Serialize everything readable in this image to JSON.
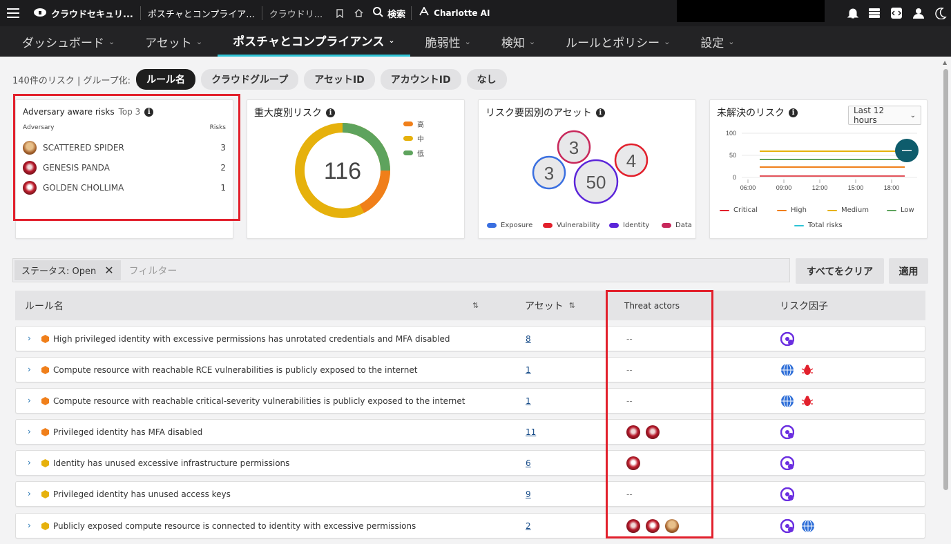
{
  "topbar": {
    "app_title": "クラウドセキュリ...",
    "crumb1": "ポスチャとコンプライア...",
    "crumb2": "クラウドリ...",
    "search_label": "検索",
    "charlotte_label": "Charlotte AI"
  },
  "nav": {
    "items": [
      {
        "label": "ダッシュボード"
      },
      {
        "label": "アセット"
      },
      {
        "label": "ポスチャとコンプライアンス"
      },
      {
        "label": "脆弱性"
      },
      {
        "label": "検知"
      },
      {
        "label": "ルールとポリシー"
      },
      {
        "label": "設定"
      }
    ]
  },
  "grouping": {
    "summary": "140件のリスク | グループ化:",
    "pills": [
      "ルール名",
      "クラウドグループ",
      "アセットID",
      "アカウントID",
      "なし"
    ]
  },
  "adversary_card": {
    "title": "Adversary aware risks",
    "top_label": "Top 3",
    "col_adversary": "Adversary",
    "col_risks": "Risks",
    "rows": [
      {
        "name": "SCATTERED SPIDER",
        "risks": "3"
      },
      {
        "name": "GENESIS PANDA",
        "risks": "2"
      },
      {
        "name": "GOLDEN CHOLLIMA",
        "risks": "1"
      }
    ]
  },
  "severity_card": {
    "title": "重大度別リスク",
    "total": "116",
    "legend": [
      "高",
      "中",
      "低"
    ]
  },
  "factor_card": {
    "title": "リスク要因別のアセット",
    "bubbles": [
      "3",
      "3",
      "50",
      "4"
    ],
    "legend": [
      "Exposure",
      "Vulnerability",
      "Identity",
      "Data"
    ]
  },
  "unresolved_card": {
    "title": "未解決のリスク",
    "range": "Last 12 hours",
    "y_ticks": [
      "100",
      "50",
      "0"
    ],
    "x_ticks": [
      "06:00",
      "09:00",
      "12:00",
      "15:00",
      "18:00"
    ],
    "legend": [
      "Critical",
      "High",
      "Medium",
      "Low",
      "Total risks"
    ]
  },
  "filter": {
    "chip_label": "ステータス: Open",
    "placeholder": "フィルター",
    "clear_all": "すべてをクリア",
    "apply": "適用"
  },
  "table": {
    "headers": {
      "rule": "ルール名",
      "assets": "アセット",
      "actors": "Threat actors",
      "factors": "リスク因子"
    },
    "rows": [
      {
        "name": "High privileged identity with excessive permissions has unrotated credentials and MFA disabled",
        "assets": "8",
        "actors_text": "--"
      },
      {
        "name": "Compute resource with reachable RCE vulnerabilities is publicly exposed to the internet",
        "assets": "1",
        "actors_text": "--"
      },
      {
        "name": "Compute resource with reachable critical-severity vulnerabilities is publicly exposed to the internet",
        "assets": "1",
        "actors_text": "--"
      },
      {
        "name": "Privileged identity has MFA disabled",
        "assets": "11",
        "actors_text": ""
      },
      {
        "name": "Identity has unused excessive infrastructure permissions",
        "assets": "6",
        "actors_text": ""
      },
      {
        "name": "Privileged identity has unused access keys",
        "assets": "9",
        "actors_text": "--"
      },
      {
        "name": "Publicly exposed compute resource is connected to identity with excessive permissions",
        "assets": "2",
        "actors_text": ""
      }
    ]
  },
  "colors": {
    "high": "#f07f1a",
    "medium": "#e6b10c",
    "low": "#5ea35d",
    "accent": "#2ec4d6",
    "highlight": "#e2202c"
  }
}
